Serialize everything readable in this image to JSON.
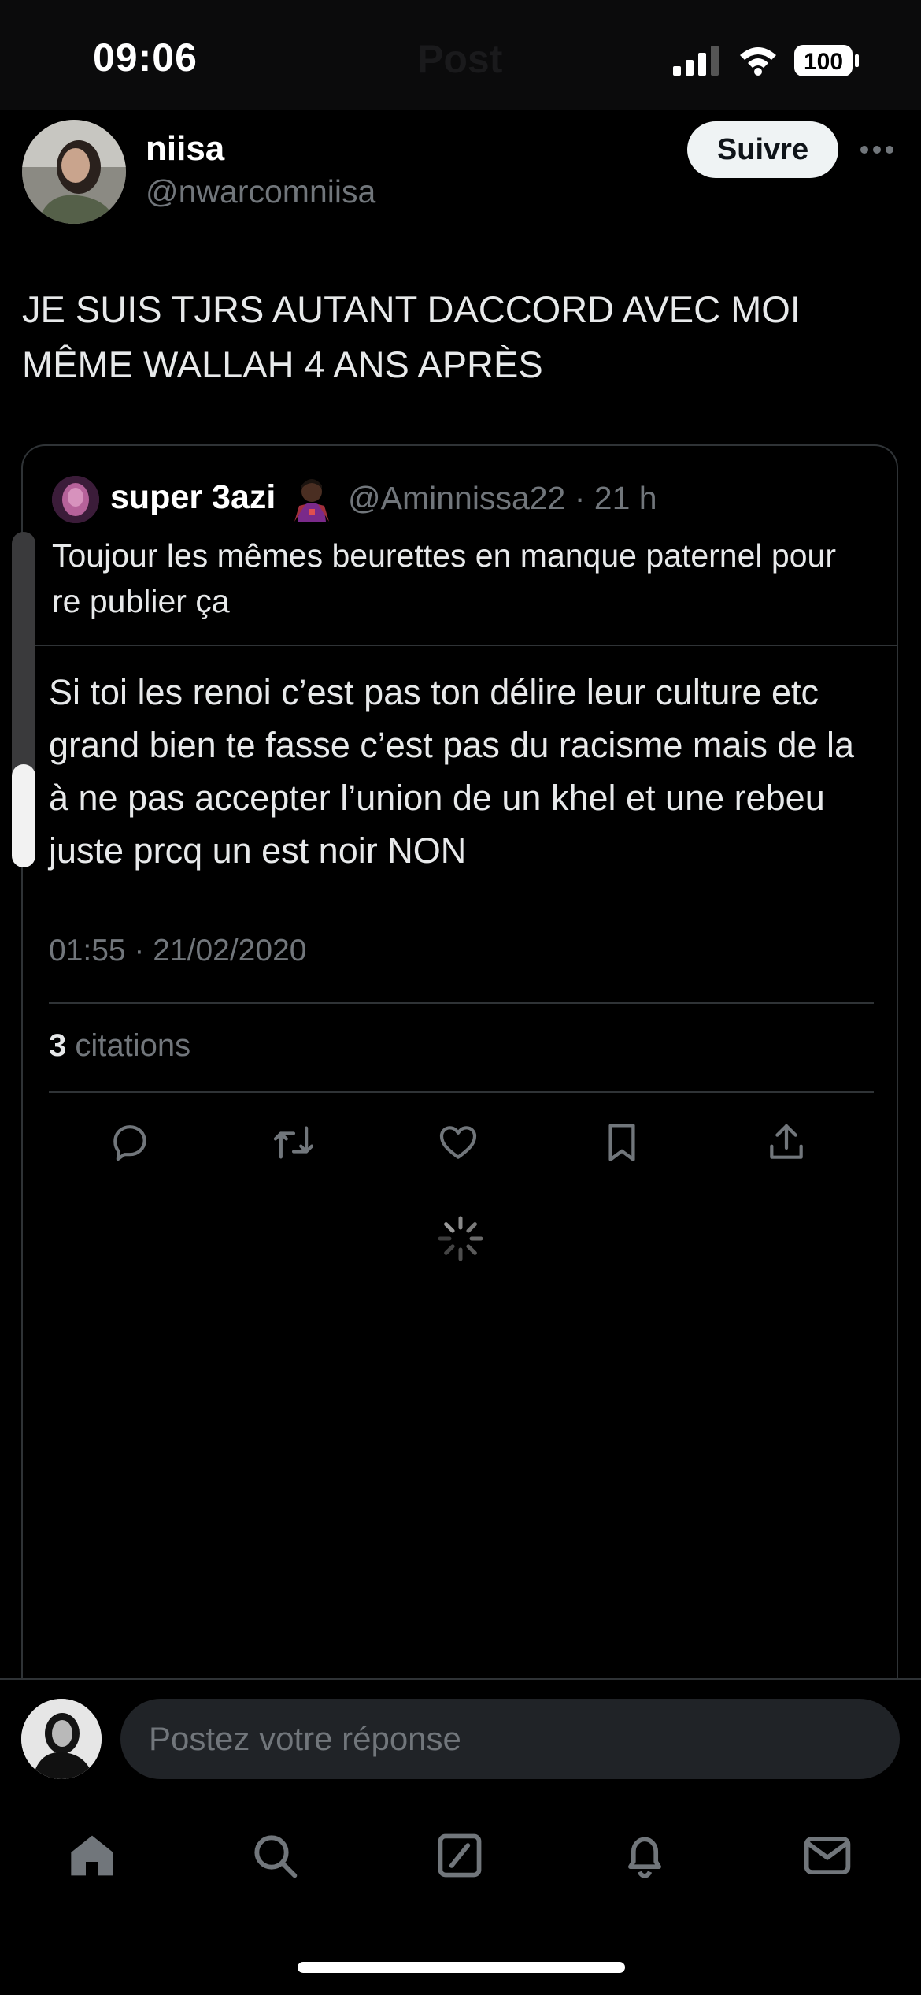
{
  "status_bar": {
    "time": "09:06",
    "ghost_title": "Post",
    "battery": "100"
  },
  "post": {
    "author_name": "niisa",
    "author_handle": "@nwarcomniisa",
    "follow_label": "Suivre",
    "text": "JE SUIS TJRS AUTANT DACCORD AVEC MOI MÊME WALLAH 4 ANS APRÈS",
    "quoted": {
      "name": "super 3azi",
      "handle_time": "@Aminnissa22 · 21 h",
      "text": "Toujour les mêmes beurettes en manque paternel pour re publier ça",
      "inner_text": "Si toi les renoi c’est pas ton délire leur culture etc grand bien te fasse c’est pas du racisme mais de la à ne pas accepter l’union de un khel et une rebeu juste prcq un est noir NON",
      "timestamp": "01:55 · 21/02/2020",
      "quotes_count": "3",
      "quotes_label": " citations"
    }
  },
  "composer": {
    "placeholder": "Postez votre réponse"
  },
  "icons": {
    "actions": [
      "reply-icon",
      "repost-icon",
      "like-icon",
      "bookmark-icon",
      "share-icon"
    ],
    "tabs": [
      "home-icon",
      "search-icon",
      "compose-icon",
      "notifications-icon",
      "messages-icon"
    ]
  },
  "colors": {
    "background": "#000000",
    "text": "#e7e9ea",
    "muted": "#71767b",
    "border": "#2f3336",
    "follow_button": "#eff3f4"
  }
}
